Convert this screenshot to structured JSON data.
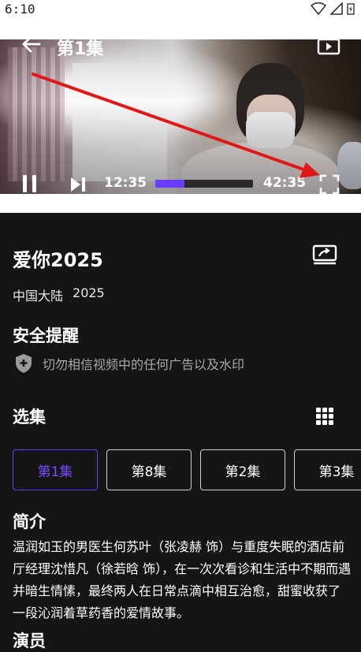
{
  "status_bar": {
    "time": "6:10"
  },
  "player": {
    "episode_title": "第1集",
    "current_time": "12:35",
    "total_time": "42:35",
    "progress_fraction": 0.3,
    "accent_color": "#6a3cff"
  },
  "show": {
    "title": "爱你2025",
    "region": "中国大陆",
    "year": "2025"
  },
  "safety": {
    "title": "安全提醒",
    "text": "切勿相信视频中的任何广告以及水印"
  },
  "episodes": {
    "title": "选集",
    "items": [
      {
        "label": "第1集",
        "active": true
      },
      {
        "label": "第8集",
        "active": false
      },
      {
        "label": "第2集",
        "active": false
      },
      {
        "label": "第3集",
        "active": false
      }
    ]
  },
  "intro": {
    "title": "简介",
    "text": "温润如玉的男医生何苏叶（张凌赫 饰）与重度失眠的酒店前厅经理沈惜凡（徐若晗 饰），在一次次看诊和生活中不期而遇并暗生情愫，最终两人在日常点滴中相互治愈，甜蜜收获了一段沁润着草药香的爱情故事。"
  },
  "cast": {
    "title": "演员"
  },
  "icons": {
    "back": "arrow-left-icon",
    "tv": "tv-icon",
    "pause": "pause-icon",
    "next": "skip-next-icon",
    "fullscreen": "fullscreen-icon",
    "cast": "screen-cast-icon",
    "shield": "shield-icon",
    "grid": "grid-icon"
  }
}
